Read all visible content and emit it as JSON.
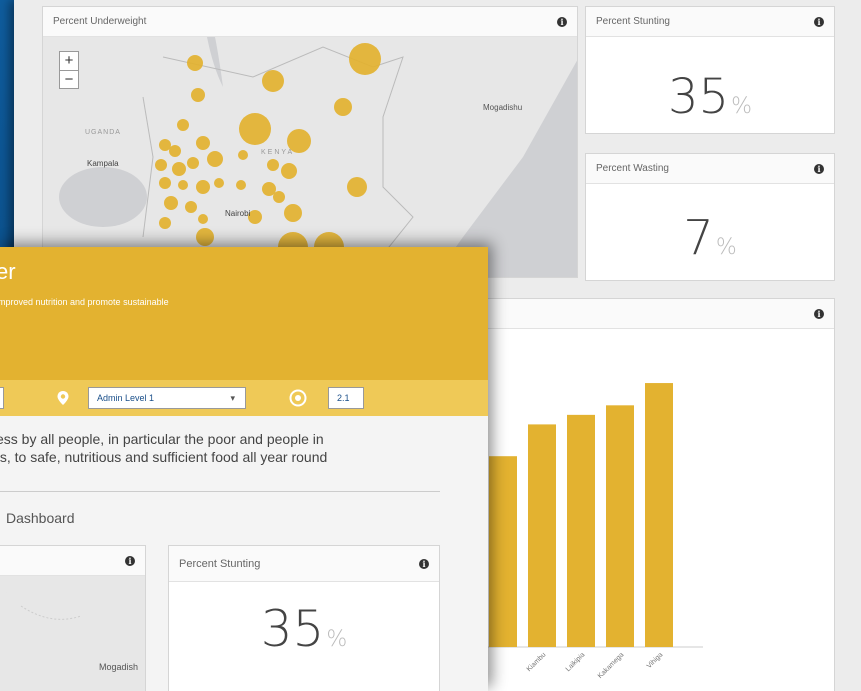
{
  "background_dashboard": {
    "underweight_card": {
      "title": "Percent Underweight",
      "map_labels": {
        "mogadishu": "Mogadishu",
        "uganda": "UGANDA",
        "kampala": "Kampala",
        "kenya": "KENYA",
        "nairobi": "Nairobi"
      },
      "zoom_in": "+",
      "zoom_out": "−"
    },
    "stunting_card": {
      "title": "Percent Stunting",
      "value": "35",
      "unit": "%"
    },
    "wasting_card": {
      "title": "Percent Wasting",
      "value": "7",
      "unit": "%"
    },
    "bar_chart_card": {
      "title": ""
    }
  },
  "front_panel": {
    "title": "er",
    "subtitle": "improved nutrition and promote sustainable",
    "toolbar": {
      "admin_level_value": "Admin Level 1",
      "indicator_value": "2.1"
    },
    "description": "ess by all people, in particular the poor and people in\nts, to safe, nutritious and sufficient food all year round",
    "dashboard_label": "Dashboard",
    "map_card": {
      "map_label": "Mogadish"
    },
    "stunting_card": {
      "title": "Percent Stunting",
      "value": "35",
      "unit": "%"
    }
  },
  "chart_data": {
    "type": "bar",
    "categories": [
      "",
      "Kiambu",
      "Laikipia",
      "Kakamega",
      "Vihiga"
    ],
    "values": [
      0.6,
      0.7,
      0.73,
      0.76,
      0.83
    ],
    "ylim": [
      0,
      1
    ]
  },
  "colors": {
    "accent": "#e3b230",
    "toolbar": "#efc957",
    "background_blue": "#0b4f8a",
    "text_link": "#1a4f8a"
  },
  "icons": {
    "info": "info-icon",
    "location": "location-pin-icon",
    "target": "target-icon",
    "dropdown": "chevron-down-icon"
  }
}
